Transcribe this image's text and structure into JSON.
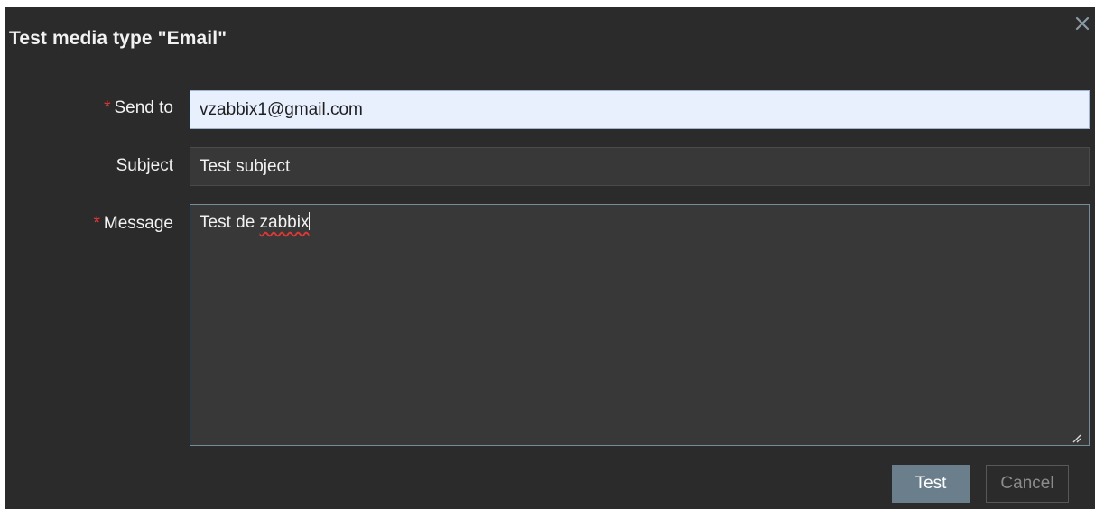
{
  "dialog": {
    "title": "Test media type \"Email\"",
    "close_icon": "close-icon"
  },
  "form": {
    "send_to": {
      "label": "Send to",
      "required_mark": "*",
      "value": "vzabbix1@gmail.com"
    },
    "subject": {
      "label": "Subject",
      "value": "Test subject"
    },
    "message": {
      "label": "Message",
      "required_mark": "*",
      "value_plain": "Test de ",
      "value_misspelled": "zabbix"
    }
  },
  "buttons": {
    "test_label": "Test",
    "cancel_label": "Cancel"
  },
  "colors": {
    "dialog_background": "#2b2b2b",
    "required_marker": "#e33734",
    "primary_button": "#6b7e8c",
    "autofill_input": "#e8f0fe"
  }
}
